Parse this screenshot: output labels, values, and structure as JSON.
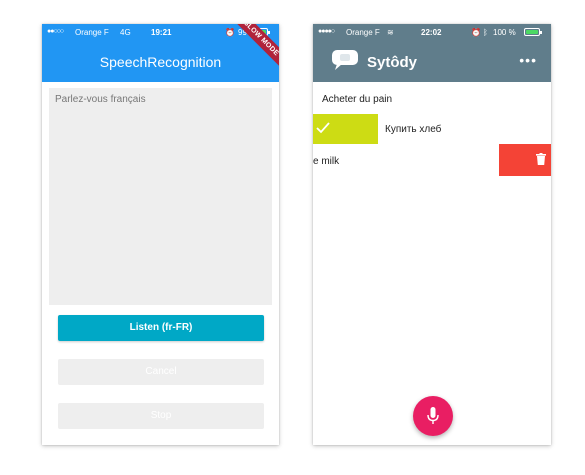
{
  "phone1": {
    "status": {
      "signal": "●●○○○",
      "carrier": "Orange F",
      "network": "4G",
      "time": "19:21",
      "battery_pct": "99"
    },
    "title": "SpeechRecognition",
    "debug_banner": "SLOW MODE",
    "text_content": "Parlez-vous français",
    "buttons": {
      "listen": "Listen (fr-FR)",
      "cancel": "Cancel",
      "stop": "Stop"
    },
    "colors": {
      "appbar": "#2196f3",
      "listen": "#00a8c6"
    }
  },
  "phone2": {
    "status": {
      "signal": "●●●●○",
      "carrier": "Orange F",
      "time": "22:02",
      "battery": "100 %"
    },
    "title": "Sytôdy",
    "items": [
      {
        "label": "Acheter du pain"
      },
      {
        "label": "Купить хлеб"
      },
      {
        "label": "e milk"
      }
    ],
    "colors": {
      "appbar": "#607d8b",
      "done": "#cddc14",
      "delete": "#f44336",
      "fab": "#e91e63"
    }
  }
}
